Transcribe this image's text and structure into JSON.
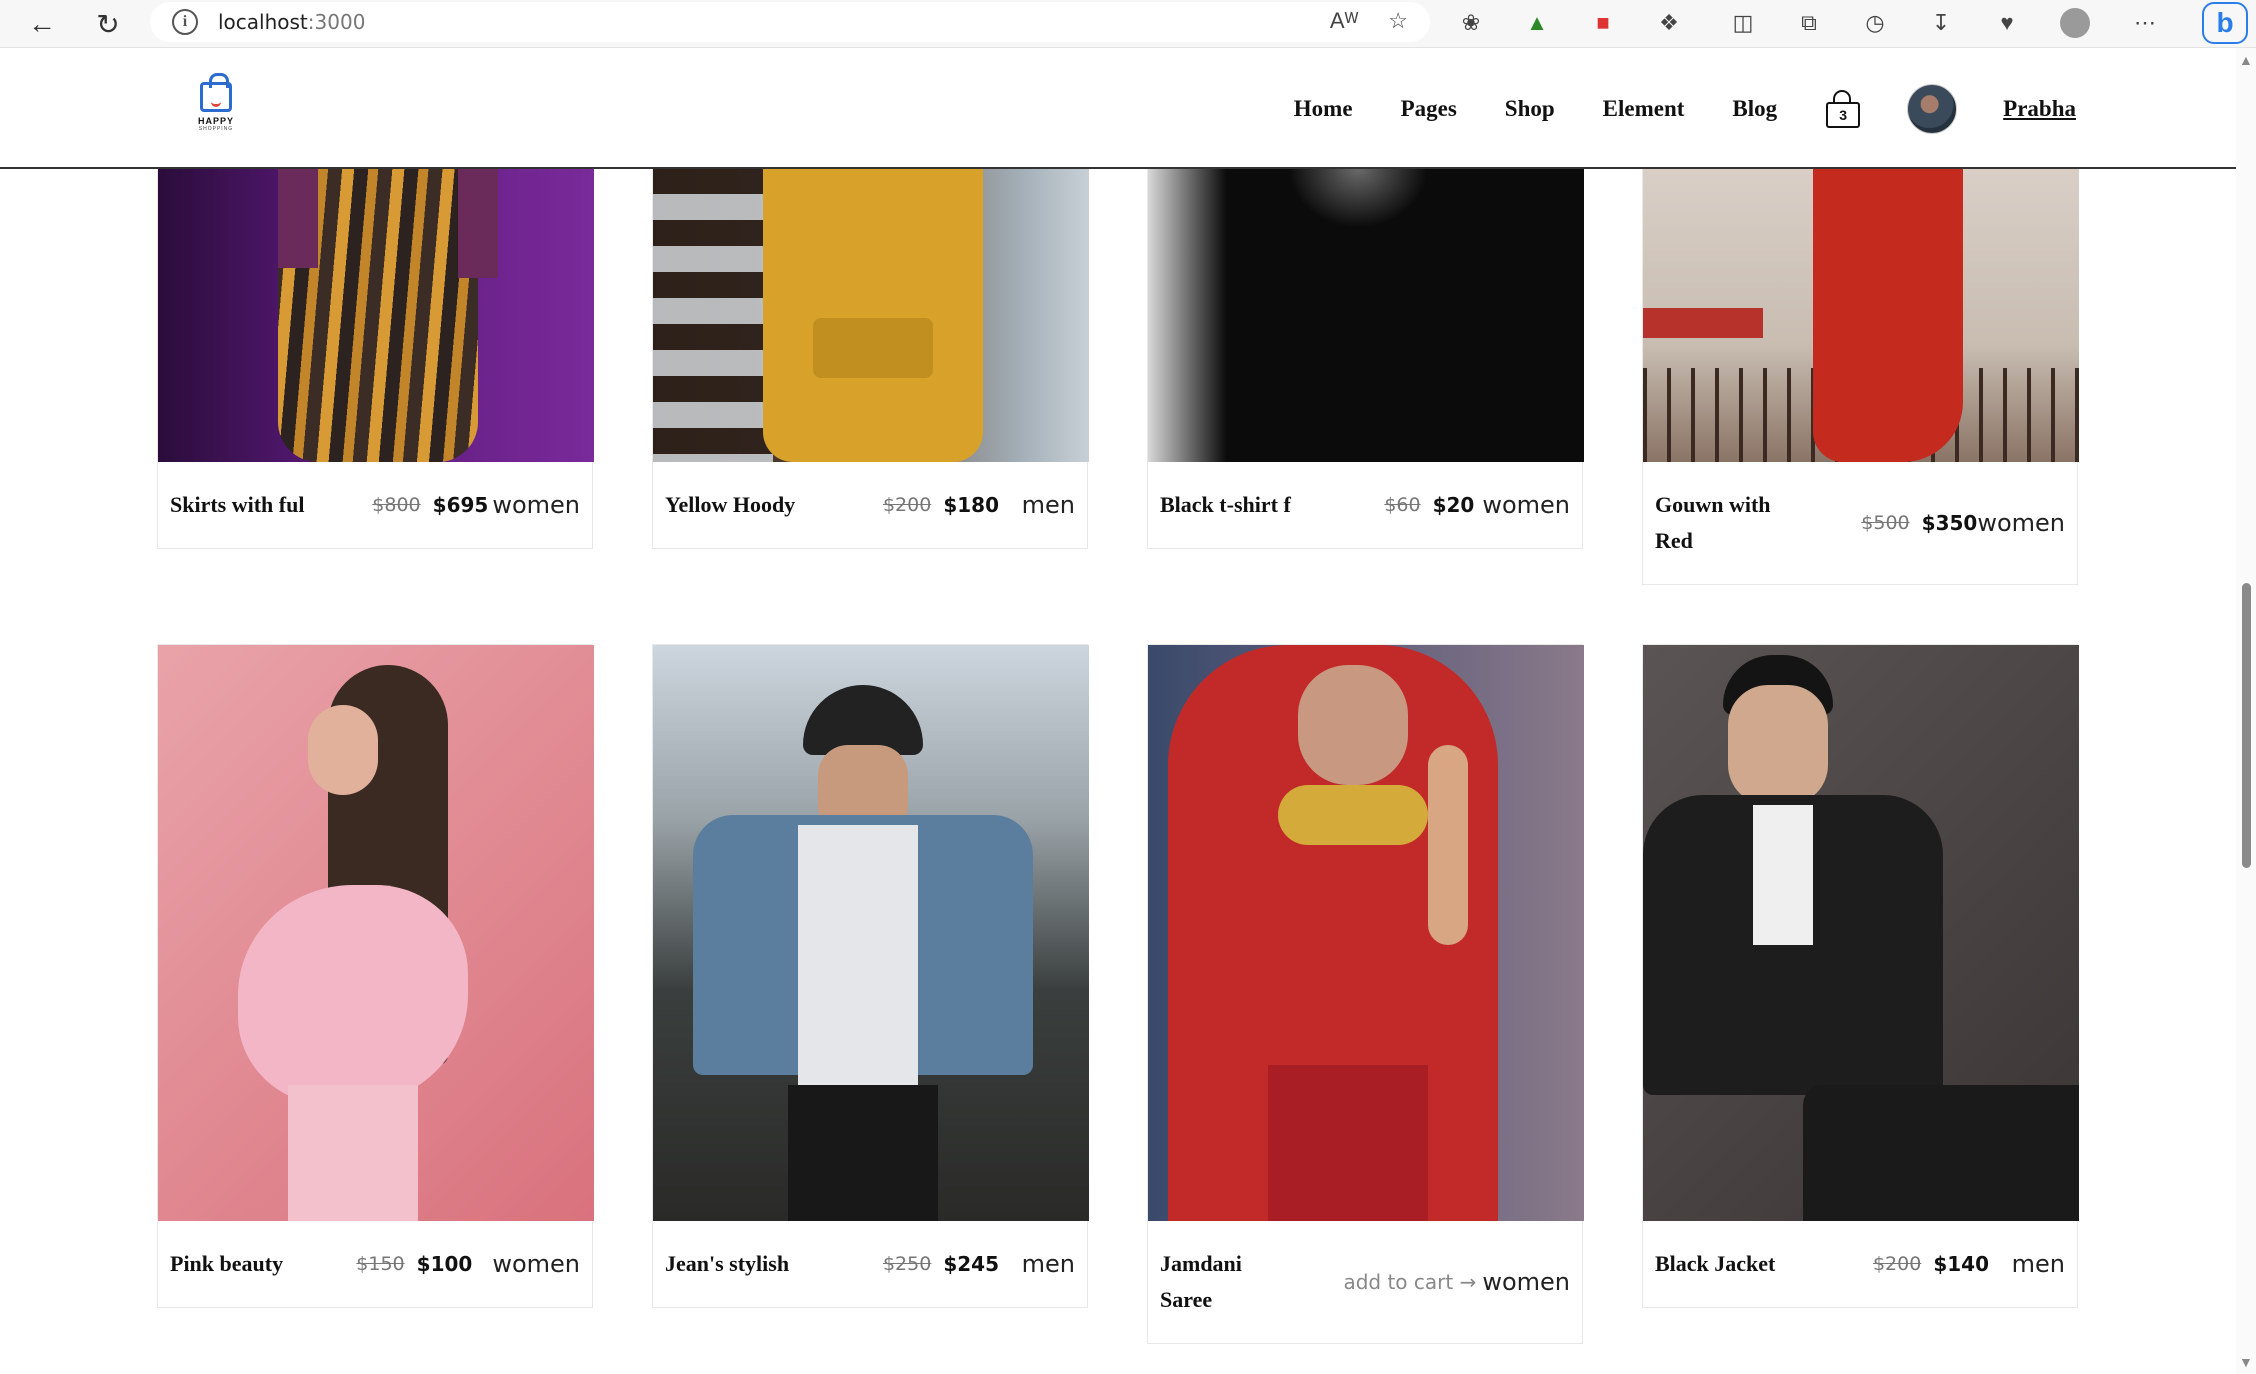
{
  "browser": {
    "url_host": "localhost",
    "url_port": ":3000",
    "icons": [
      "back-icon",
      "reload-icon",
      "info-icon",
      "read-aloud-icon",
      "favorite-star-icon",
      "bug-icon",
      "html-icon",
      "color-picker-icon",
      "extensions-icon",
      "split-screen-icon",
      "collections-icon",
      "history-icon",
      "download-icon",
      "browser-essentials-icon",
      "profile-icon",
      "more-icon",
      "bing-copilot-icon"
    ]
  },
  "site": {
    "logo_line1": "HAPPY",
    "logo_line2": "SHOPPING",
    "nav": [
      "Home",
      "Pages",
      "Shop",
      "Element",
      "Blog"
    ],
    "cart_count": "3",
    "user_name": "Prabha"
  },
  "products": [
    {
      "name": "Skirts with ful",
      "old_price": "$800",
      "price": "$695",
      "category": "women"
    },
    {
      "name": "Yellow Hoody",
      "old_price": "$200",
      "price": "$180",
      "category": "men"
    },
    {
      "name": "Black t-shirt f",
      "old_price": "$60",
      "price": "$20",
      "category": "women"
    },
    {
      "name_line1": "Gouwn with",
      "name_line2": "Red",
      "old_price": "$500",
      "price": "$350",
      "category": "women"
    },
    {
      "name": "Pink beauty",
      "old_price": "$150",
      "price": "$100",
      "category": "women"
    },
    {
      "name": "Jean's stylish",
      "old_price": "$250",
      "price": "$245",
      "category": "men"
    },
    {
      "name_line1": "Jamdani",
      "name_line2": "Saree",
      "add_to_cart": "add to cart →",
      "category": "women"
    },
    {
      "name": "Black Jacket",
      "old_price": "$200",
      "price": "$140",
      "category": "men"
    }
  ],
  "colors": {
    "accent_blue": "#2c6ccf",
    "text": "#111111",
    "muted": "#777777"
  }
}
